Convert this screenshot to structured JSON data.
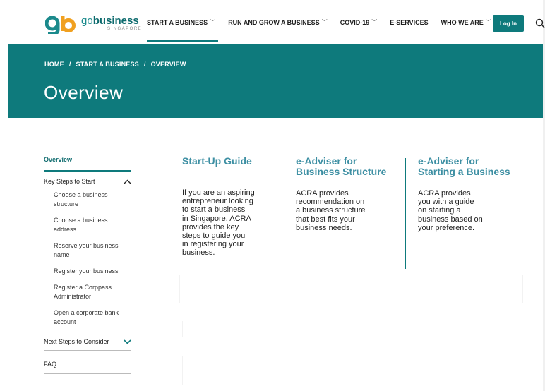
{
  "logo": {
    "go": "go",
    "business": "business",
    "sub": "SINGAPORE"
  },
  "nav": [
    {
      "label": "START A BUSINESS",
      "chevron": true,
      "active": true
    },
    {
      "label": "RUN AND GROW A BUSINESS",
      "chevron": true,
      "active": false
    },
    {
      "label": "COVID-19",
      "chevron": true,
      "active": false
    },
    {
      "label": "E-SERVICES",
      "chevron": false,
      "active": false
    },
    {
      "label": "WHO WE ARE",
      "chevron": true,
      "active": false
    }
  ],
  "login_label": "Log In",
  "search_icon": "search-icon",
  "breadcrumb": {
    "home": "HOME",
    "section": "START A BUSINESS",
    "current": "OVERVIEW",
    "separator": "/"
  },
  "page_title": "Overview",
  "sidebar": {
    "overview": "Overview",
    "key_steps": "Key Steps to Start",
    "key_steps_items": [
      "Choose a business structure",
      "Choose a business address",
      "Reserve your business name",
      "Register your business",
      "Register a Corppass Administrator",
      "Open a corporate bank account"
    ],
    "next_steps": "Next Steps to Consider",
    "faq": "FAQ"
  },
  "cards": [
    {
      "title": "Start-Up Guide",
      "body": [
        "If you are an aspiring",
        "entrepreneur looking",
        "to start a business",
        "in Singapore, ACRA",
        "provides the key",
        "steps to guide you",
        "in registering your",
        "business."
      ]
    },
    {
      "title": "e-Adviser for Business Structure",
      "title_lines": [
        "e-Adviser for",
        "Business Structure"
      ],
      "body": [
        "ACRA provides",
        "recommendation on",
        "a business structure",
        "that best fits your",
        "business needs."
      ]
    },
    {
      "title": "e-Adviser for Starting a Business",
      "title_lines": [
        "e-Adviser for",
        "Starting a Business"
      ],
      "body": [
        "ACRA provides",
        "you with a guide",
        "on starting a",
        "business based on",
        "your preference."
      ]
    }
  ],
  "colors": {
    "brand": "#0e7a7c",
    "card_title": "#3d8fa3"
  }
}
